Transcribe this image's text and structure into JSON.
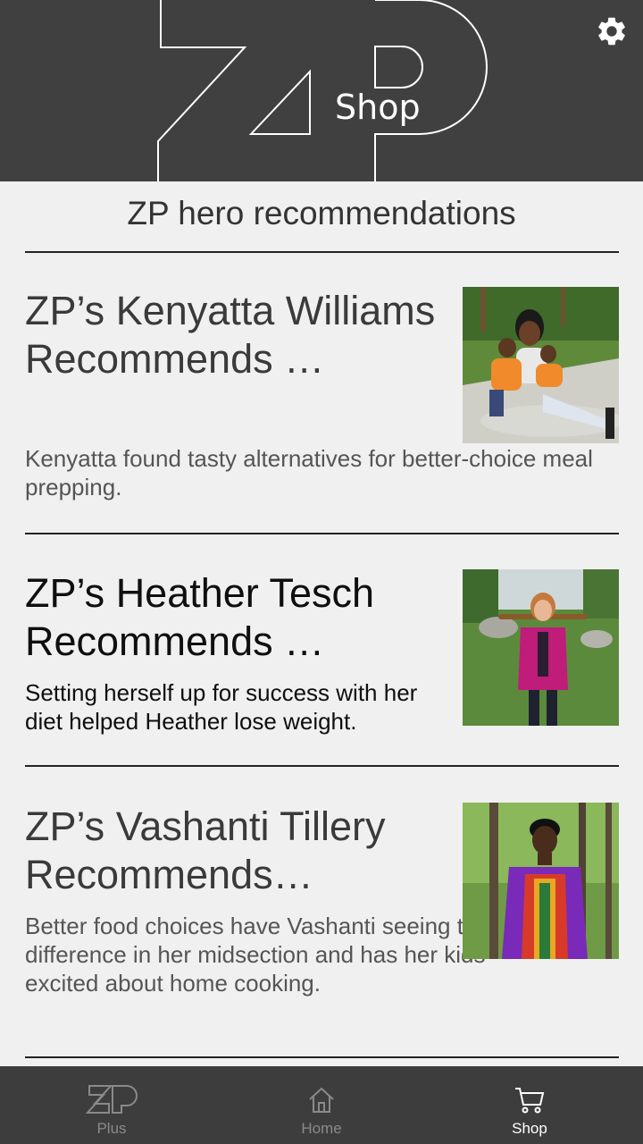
{
  "header": {
    "logo_text": "ZP",
    "shop_label": "Shop",
    "settings_icon": "gear-icon"
  },
  "main": {
    "section_title": "ZP hero recommendations",
    "cards": [
      {
        "title": "ZP’s Kenyatta Williams Recommends …",
        "description": "Kenyatta found tasty alternatives for better-choice meal prepping.",
        "image": "photo-woman-with-two-children"
      },
      {
        "title": "ZP’s Heather Tesch Recommends …",
        "description": "Setting herself up for success with her diet helped Heather lose weight.",
        "image": "photo-woman-in-magenta-outdoors"
      },
      {
        "title": "ZP’s Vashanti Tillery Recommends…",
        "description": "Better food choices have Vashanti seeing the difference in her midsection and has her kids excited about home cooking.",
        "image": "photo-woman-in-purple-dress-forest"
      }
    ]
  },
  "tabbar": {
    "tabs": [
      {
        "label": "Plus",
        "icon": "zp-logo-icon",
        "active": false
      },
      {
        "label": "Home",
        "icon": "home-icon",
        "active": false
      },
      {
        "label": "Shop",
        "icon": "cart-icon",
        "active": true
      }
    ]
  },
  "colors": {
    "header_bg": "#404040",
    "page_bg": "#f0f0f0",
    "tabbar_bg": "#3d3d3d",
    "active_tab": "#ffffff",
    "inactive_tab": "#8a8a8a"
  }
}
